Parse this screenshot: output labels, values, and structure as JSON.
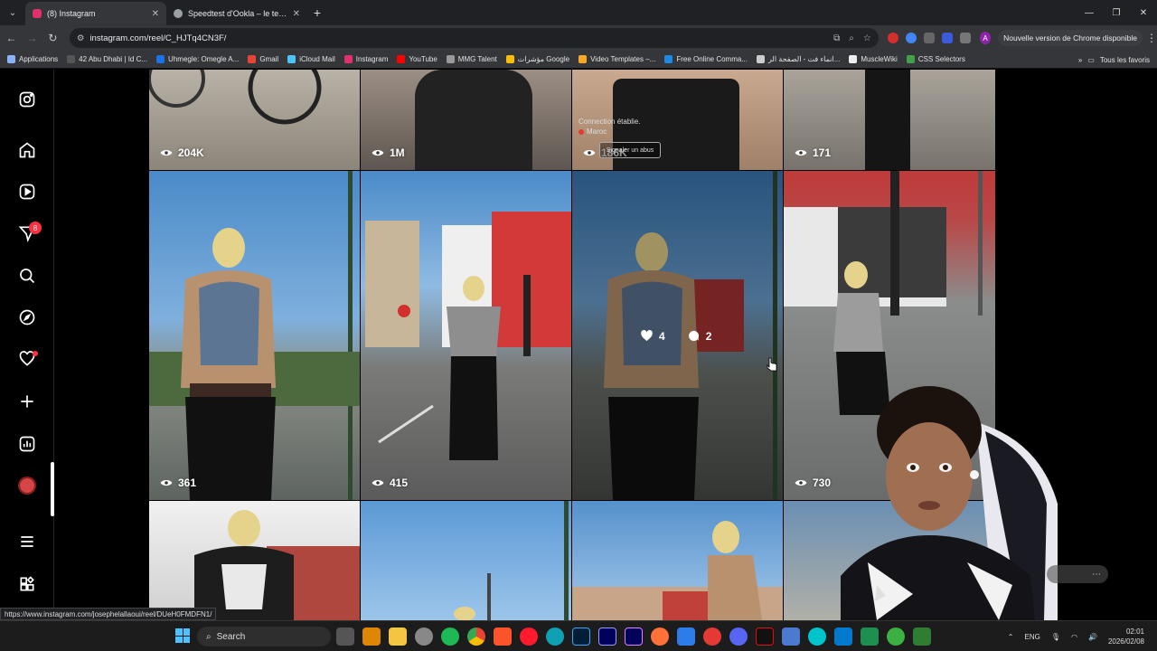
{
  "browser": {
    "tabs": [
      {
        "title": "(8) Instagram",
        "active": true,
        "favicon_color": "#e1306c"
      },
      {
        "title": "Speedtest d'Ookla – le test de v",
        "active": false,
        "favicon_color": "#9aa0a6"
      }
    ],
    "url": "instagram.com/reel/C_HJTq4CN3F/",
    "update_label": "Nouvelle version de Chrome disponible",
    "profile_initial": "A",
    "bookmarks": [
      {
        "label": "Applications",
        "color": "#8ab4f8"
      },
      {
        "label": "42 Abu Dhabi | Id C...",
        "color": "#555"
      },
      {
        "label": "Uhmegle: Omegle A...",
        "color": "#1a73e8"
      },
      {
        "label": "Gmail",
        "color": "#ea4335"
      },
      {
        "label": "iCloud Mail",
        "color": "#4fc3f7"
      },
      {
        "label": "Instagram",
        "color": "#e1306c"
      },
      {
        "label": "YouTube",
        "color": "#ff0000"
      },
      {
        "label": "MMG Talent",
        "color": "#999"
      },
      {
        "label": "مؤشرات Google",
        "color": "#fbbc04"
      },
      {
        "label": "Video Templates –...",
        "color": "#f9a825"
      },
      {
        "label": "Free Online Comma...",
        "color": "#1e88e5"
      },
      {
        "label": "انماء فت - الصفحة الر...",
        "color": "#ccc"
      },
      {
        "label": "MuscleWiki",
        "color": "#eee"
      },
      {
        "label": "CSS Selectors",
        "color": "#43a047"
      }
    ],
    "all_bookmarks_label": "Tous les favoris",
    "status_url": "https://www.instagram.com/josephelallaoui/reel/DUeH0FMDFN1/"
  },
  "instagram": {
    "notification_count": "8",
    "top_row_views": [
      "204K",
      "1M",
      "186K",
      "171"
    ],
    "middle_row_views": [
      "361",
      "415",
      "730"
    ],
    "hover_stats": {
      "likes": "4",
      "comments": "2"
    },
    "toast_line1": "Connection établie.",
    "toast_line2": "Maroc",
    "toast_button": "Signaler un abus"
  },
  "taskbar": {
    "search_label": "Search",
    "language": "ENG",
    "time": "02:01",
    "date": "2026/02/08"
  },
  "colors": {
    "accent": "#0095f6",
    "notification": "#ff3040",
    "sky": "#4a8ac8"
  }
}
